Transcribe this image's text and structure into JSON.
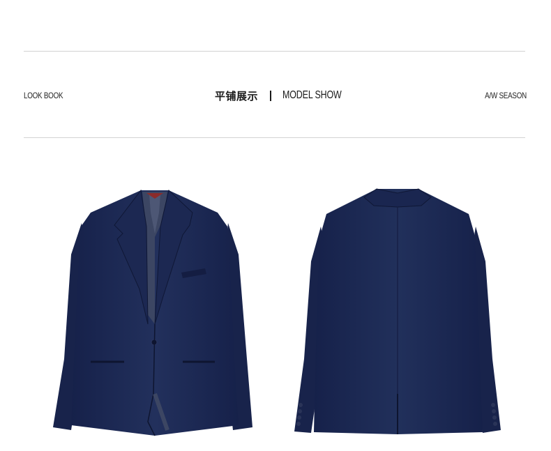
{
  "header": {
    "left_label": "LOOK BOOK",
    "center_title_cn": "平铺展示",
    "center_title_en": "MODEL SHOW",
    "right_label": "A/W SEASON"
  },
  "colors": {
    "navy": "#1d2b54",
    "navy_dark": "#121b3a",
    "lining": "#3c4663",
    "rule": "#d2d2d2"
  },
  "images": {
    "front": "navy-blazer-front",
    "back": "navy-blazer-back"
  }
}
